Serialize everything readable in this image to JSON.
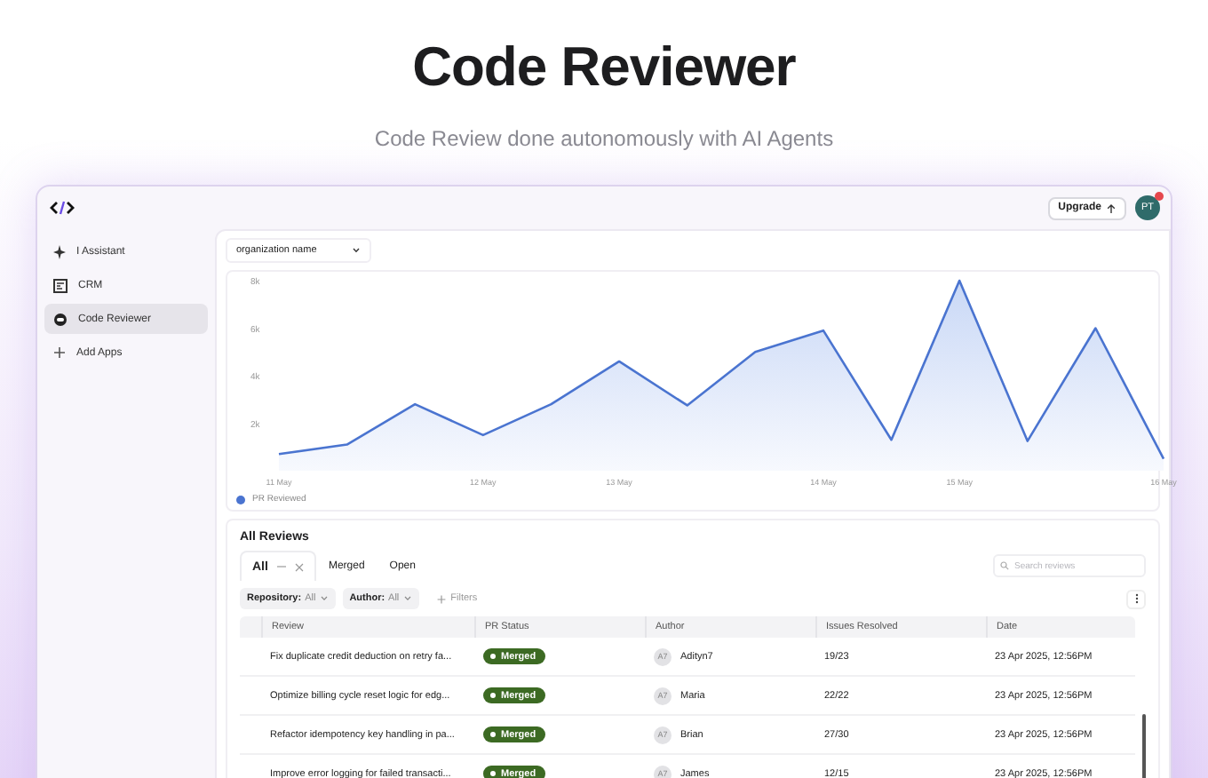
{
  "hero": {
    "title": "Code Reviewer",
    "subtitle": "Code Review done autonomously with AI Agents"
  },
  "topbar": {
    "upgrade": "Upgrade",
    "avatar": {
      "initials": "PT",
      "notification": true
    }
  },
  "sidebar": {
    "items": [
      {
        "label": "I Assistant",
        "selected": false
      },
      {
        "label": "CRM",
        "selected": false
      },
      {
        "label": "Code Reviewer",
        "selected": true
      },
      {
        "label": "Add Apps",
        "selected": false
      }
    ]
  },
  "org_select": {
    "value": "organization name"
  },
  "chart": {
    "chart_data": {
      "type": "area",
      "categories": [
        "11 May",
        null,
        null,
        "12 May",
        null,
        "13 May",
        null,
        null,
        "14 May",
        null,
        "15 May",
        null,
        null,
        "16 May"
      ],
      "series": [
        {
          "name": "PR Reviewed",
          "color": "#4a74d0",
          "values": [
            700,
            1100,
            2800,
            1500,
            2800,
            4600,
            2750,
            5000,
            5900,
            1300,
            8000,
            1250,
            6000,
            500
          ]
        }
      ],
      "ylim": [
        0,
        8000
      ],
      "yticks": [
        {
          "value": 2000,
          "label": "2k"
        },
        {
          "value": 4000,
          "label": "4k"
        },
        {
          "value": 6000,
          "label": "6k"
        },
        {
          "value": 8000,
          "label": "8k"
        }
      ]
    }
  },
  "reviews": {
    "title": "All Reviews",
    "tabs": [
      {
        "label": "All",
        "selected": true
      },
      {
        "label": "Merged",
        "selected": false
      },
      {
        "label": "Open",
        "selected": false
      }
    ],
    "search": {
      "placeholder": "Search reviews"
    },
    "filters": [
      {
        "label": "Repository:",
        "value": "All"
      },
      {
        "label": "Author:",
        "value": "All"
      }
    ],
    "add_filter": "Filters",
    "columns": [
      "Review",
      "PR Status",
      "Author",
      "Issues Resolved",
      "Date"
    ],
    "rows": [
      {
        "review": "Fix duplicate credit deduction on retry fa...",
        "status": "Merged",
        "initials": "A7",
        "author": "Adityn7",
        "issues": "19/23",
        "date": "23 Apr 2025, 12:56PM"
      },
      {
        "review": "Optimize billing cycle reset logic for edg...",
        "status": "Merged",
        "initials": "A7",
        "author": "Maria",
        "issues": "22/22",
        "date": "23 Apr 2025, 12:56PM"
      },
      {
        "review": "Refactor idempotency key handling in pa...",
        "status": "Merged",
        "initials": "A7",
        "author": "Brian",
        "issues": "27/30",
        "date": "23 Apr 2025, 12:56PM"
      },
      {
        "review": "Improve error logging for failed transacti...",
        "status": "Merged",
        "initials": "A7",
        "author": "James",
        "issues": "12/15",
        "date": "23 Apr 2025, 12:56PM"
      }
    ]
  }
}
